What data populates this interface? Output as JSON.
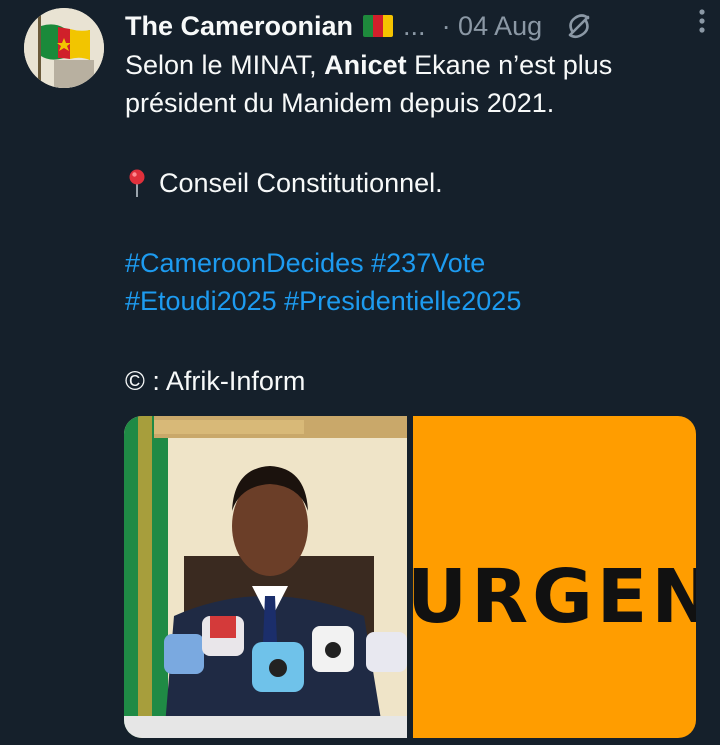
{
  "tweet": {
    "author_name": "The Cameroonian",
    "ellipsis": "...",
    "date": "· 04 Aug",
    "text_line1_before": "Selon le MINAT, ",
    "text_line1_bold": "Anicet",
    "text_line1_after": " Ekane n’est plus",
    "text_line2": "président du Manidem depuis 2021.",
    "location_text": "Conseil Constitutionnel.",
    "hashtags_line1": [
      "#CameroonDecides",
      "#237Vote"
    ],
    "hashtags_line2": [
      "#Etoudi2025",
      "#Presidentielle2025"
    ],
    "credit": "© : Afrik-Inform"
  },
  "media": {
    "urgent_text": "URGENT",
    "urgent_bg": "#ff9d00"
  },
  "icons": {
    "flag": "cameroon-flag-emoji",
    "grok": "grok-icon",
    "more": "more-vertical-icon",
    "pin": "round-pushpin-emoji"
  },
  "colors": {
    "background": "#15202b",
    "text": "#f7f9f9",
    "secondary": "#8b98a5",
    "link": "#1d9bf0"
  }
}
